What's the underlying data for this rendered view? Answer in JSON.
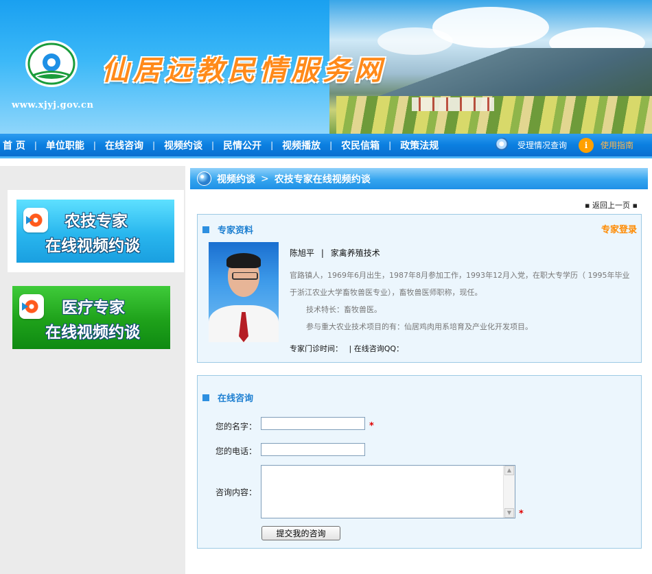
{
  "site": {
    "title": "仙居远教民情服务网",
    "url": "www.xjyj.gov.cn"
  },
  "nav": {
    "items": [
      "首 页",
      "单位职能",
      "在线咨询",
      "视频约谈",
      "民情公开",
      "视频播放",
      "农民信箱",
      "政策法规"
    ],
    "separator": "|",
    "query_label": "受理情况查询",
    "guide_label": "使用指南",
    "query_color": "#ffffff",
    "guide_color": "#ffa726"
  },
  "left_promos": [
    {
      "line1": "农技专家",
      "line2": "在线视频约谈",
      "icon": "video-play-icon"
    },
    {
      "line1": "医疗专家",
      "line2": "在线视频约谈",
      "icon": "video-play-icon"
    }
  ],
  "breadcrumb": {
    "section": "视频约谈",
    "separator": ">",
    "page": "农技专家在线视频约谈"
  },
  "back_link": "▪ 返回上一页 ▪",
  "expert": {
    "section_title": "专家资料",
    "login_label": "专家登录",
    "name": "陈旭平",
    "divider": "|",
    "specialty": "家禽养殖技术",
    "bio_line1": "官路镇人，1969年6月出生，1987年8月参加工作，1993年12月入党，在职大专学历（ 1995年毕业",
    "bio_line2": "于浙江农业大学畜牧兽医专业），畜牧兽医师职称，现任。",
    "skill": "技术特长：畜牧兽医。",
    "projects": "参与重大农业技术项目的有：仙居鸡肉用系培育及产业化开发项目。",
    "clinic_time_label": "专家门诊时间：",
    "qq_label": "| 在线咨询QQ："
  },
  "consult": {
    "section_title": "在线咨询",
    "name_label": "您的名字：",
    "phone_label": "您的电话：",
    "content_label": "咨询内容：",
    "name_value": "",
    "phone_value": "",
    "content_value": "",
    "required_mark": "*",
    "submit_label": "提交我的咨询"
  },
  "colors": {
    "nav_blue": "#0b7fe0",
    "title_orange": "#ff8a1a",
    "section_blue": "#1d7fd1",
    "login_orange": "#ff8a00",
    "required_red": "#e00000",
    "box_bg": "#ecf6fd"
  }
}
